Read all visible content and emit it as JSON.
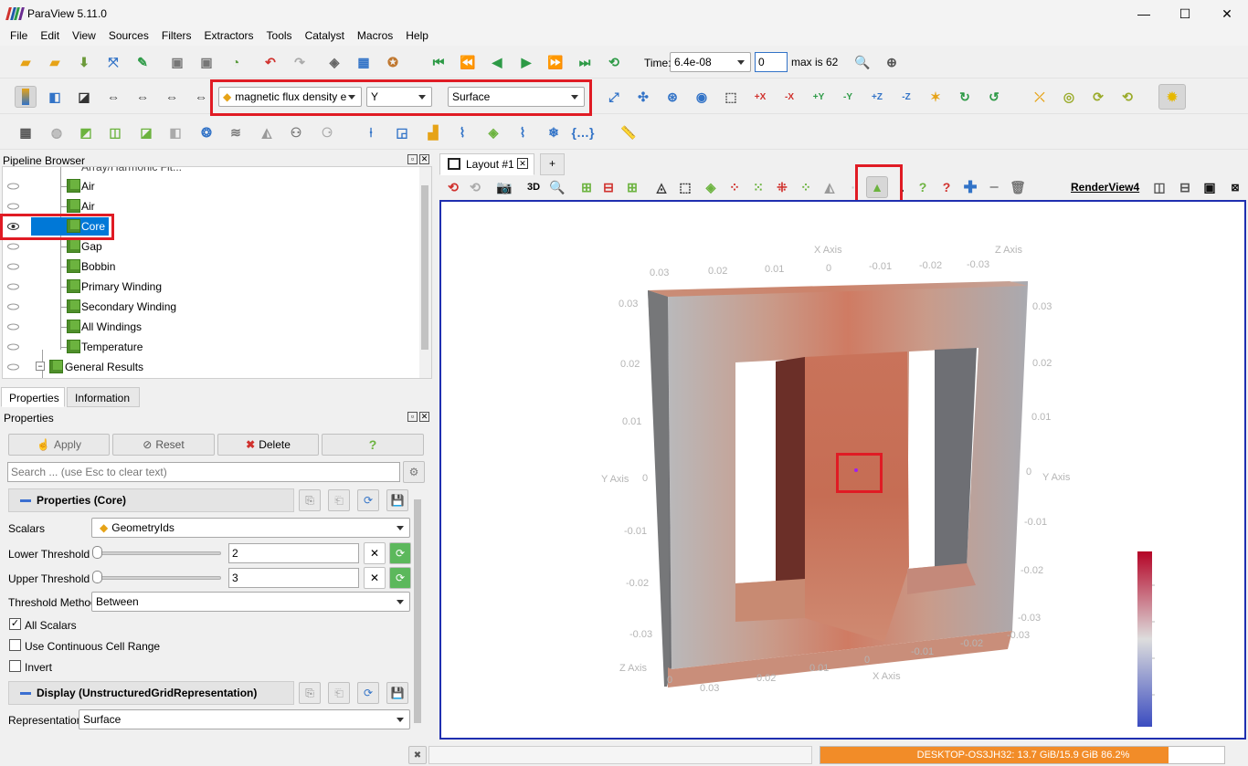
{
  "window": {
    "title": "ParaView 5.11.0",
    "min": "—",
    "max": "☐",
    "close": "✕"
  },
  "menu": [
    "File",
    "Edit",
    "View",
    "Sources",
    "Filters",
    "Extractors",
    "Tools",
    "Catalyst",
    "Macros",
    "Help"
  ],
  "toolbar": {
    "time_label": "Time:",
    "time_value": "6.4e-08",
    "timestep_value": "0",
    "max_label": "max is 62",
    "color_by": "magnetic flux density e",
    "component": "Y",
    "representation": "Surface"
  },
  "pipeline": {
    "title": "Pipeline Browser",
    "partial_item": "Array/Harmonic Fit...",
    "items": [
      {
        "label": "Air",
        "visible": false,
        "selected": false
      },
      {
        "label": "Air",
        "visible": false,
        "selected": false
      },
      {
        "label": "Core",
        "visible": true,
        "selected": true
      },
      {
        "label": "Gap",
        "visible": false,
        "selected": false
      },
      {
        "label": "Bobbin",
        "visible": false,
        "selected": false
      },
      {
        "label": "Primary Winding",
        "visible": false,
        "selected": false
      },
      {
        "label": "Secondary Winding",
        "visible": false,
        "selected": false
      },
      {
        "label": "All Windings",
        "visible": false,
        "selected": false
      },
      {
        "label": "Temperature",
        "visible": false,
        "selected": false
      },
      {
        "label": "General Results",
        "visible": false,
        "selected": false
      }
    ]
  },
  "tabs": {
    "properties": "Properties",
    "information": "Information"
  },
  "properties": {
    "title": "Properties",
    "apply": "Apply",
    "reset": "Reset",
    "delete": "Delete",
    "help": "?",
    "search_placeholder": "Search ... (use Esc to clear text)",
    "section_core": "Properties (Core)",
    "scalars_label": "Scalars",
    "scalars_value": "GeometryIds",
    "lower_label": "Lower Threshold",
    "lower_value": "2",
    "upper_label": "Upper Threshold",
    "upper_value": "3",
    "method_label": "Threshold Method",
    "method_value": "Between",
    "all_scalars": "All Scalars",
    "continuous_range": "Use Continuous Cell Range",
    "invert": "Invert",
    "section_display": "Display (UnstructuredGridRepresentation)",
    "representation_label": "Representation",
    "representation_value": "Surface"
  },
  "layout": {
    "tab": "Layout #1",
    "add": "+",
    "view_name": "RenderView4",
    "btn_3d": "3D"
  },
  "axes": {
    "x_axis": "X Axis",
    "y_axis_left": "Y Axis",
    "y_axis_right": "Y Axis",
    "z_axis_top": "Z Axis",
    "z_axis_bottom": "Z Axis",
    "top_ticks": [
      "0.03",
      "0.02",
      "0.01",
      "0",
      "-0.01",
      "-0.02",
      "-0.03"
    ],
    "left_ticks": [
      "0.03",
      "0.02",
      "0.01",
      "0",
      "-0.01",
      "-0.02",
      "-0.03"
    ],
    "right_ticks": [
      "0.03",
      "0.02",
      "0.01",
      "0",
      "-0.01",
      "-0.02",
      "-0.03"
    ],
    "bottom_left_ticks": [
      "0",
      "0.03",
      "0.02",
      "0.01"
    ],
    "bottom_right_ticks": [
      "0",
      "-0.01",
      "-0.02",
      "-0.03"
    ],
    "bottom_x_label": "X Axis"
  },
  "status": {
    "memory": "DESKTOP-OS3JH32: 13.7 GiB/15.9 GiB 86.2%",
    "memory_fraction": 0.862
  },
  "colors": {
    "accent": "#0078d7",
    "highlight": "#e01b24",
    "viewport_border": "#1f2fb0",
    "memory_bar": "#f28c28"
  }
}
